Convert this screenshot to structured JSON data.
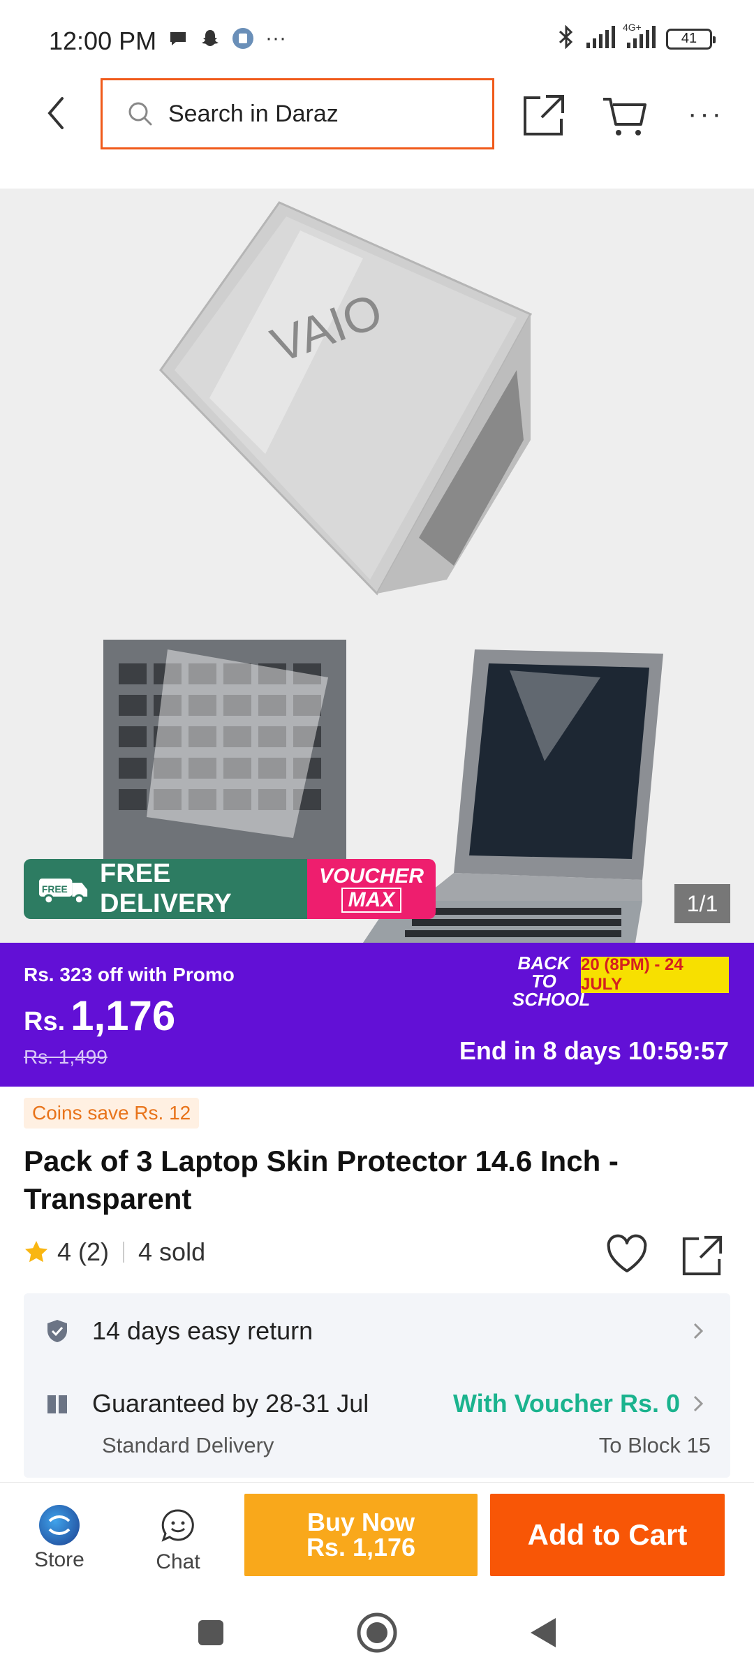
{
  "status_bar": {
    "time": "12:00 PM",
    "more": "···",
    "network": "4G+",
    "battery": "41"
  },
  "header": {
    "search_placeholder": "Search in Daraz",
    "more_label": "···"
  },
  "gallery": {
    "counter": "1/1",
    "promo_free_delivery": "FREE DELIVERY",
    "promo_free_tag": "FREE",
    "promo_voucher_line1": "VOUCHER",
    "promo_voucher_line2": "MAX"
  },
  "price_band": {
    "promo_text": "Rs. 323 off with Promo",
    "currency": "Rs.",
    "price": "1,176",
    "old_price": "Rs. 1,499",
    "campaign_line1": "BACK TO",
    "campaign_line2": "SCHOOL",
    "campaign_dates": "20 (8PM) - 24 JULY",
    "countdown": "End in 8 days 10:59:57",
    "bg_color": "#6210d6"
  },
  "product": {
    "coins_badge": "Coins save Rs. 12",
    "title": "Pack of 3 Laptop Skin Protector 14.6 Inch - Transparent",
    "rating": "4",
    "rating_count": "(2)",
    "sold": "4 sold"
  },
  "services": {
    "return_text": "14 days easy return",
    "delivery_text": "Guaranteed by 28-31 Jul",
    "voucher_text": "With Voucher Rs. 0",
    "delivery_type": "Standard Delivery",
    "delivery_location": "To Block 15"
  },
  "action_bar": {
    "store_label": "Store",
    "chat_label": "Chat",
    "buy_now_line1": "Buy Now",
    "buy_now_line2": "Rs. 1,176",
    "add_to_cart": "Add to Cart",
    "buy_now_color": "#f9a81b",
    "add_to_cart_color": "#f85606"
  }
}
